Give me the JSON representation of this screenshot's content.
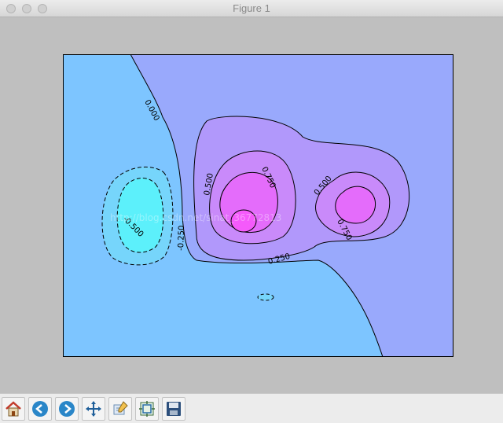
{
  "window": {
    "title": "Figure 1"
  },
  "chart_data": {
    "type": "contour",
    "filled": true,
    "colormap": "cool",
    "contour_levels": [
      -0.5,
      -0.25,
      0.0,
      0.25,
      0.5,
      0.75
    ],
    "contour_labels": [
      {
        "text": "0.000"
      },
      {
        "text": "0.500"
      },
      {
        "text": "0.750"
      },
      {
        "text": "0.500"
      },
      {
        "text": "0.750"
      },
      {
        "text": "0.250"
      },
      {
        "text": "-0.250"
      },
      {
        "text": "-0.500"
      }
    ],
    "negative_linestyle": "dashed",
    "axes_ticks": "none",
    "colors": {
      "band_neg": "#5cf0fb",
      "band_neg_mid": "#76d5fb",
      "band_zero_neg": "#7dc5ff",
      "band_zero_pos": "#99a9fc",
      "band_025": "#b198fb",
      "band_050": "#c98afa",
      "band_075": "#e46cfb",
      "band_peak": "#f55afb"
    },
    "watermark": "http://blog.csdn.net/sinat_36772813"
  },
  "toolbar": {
    "buttons": [
      {
        "name": "home-button",
        "icon": "home-icon"
      },
      {
        "name": "back-button",
        "icon": "back-arrow-icon"
      },
      {
        "name": "forward-button",
        "icon": "forward-arrow-icon"
      },
      {
        "name": "pan-button",
        "icon": "move-icon"
      },
      {
        "name": "zoom-button",
        "icon": "zoom-rect-icon"
      },
      {
        "name": "subplots-button",
        "icon": "subplots-icon"
      },
      {
        "name": "save-button",
        "icon": "save-icon"
      }
    ]
  }
}
